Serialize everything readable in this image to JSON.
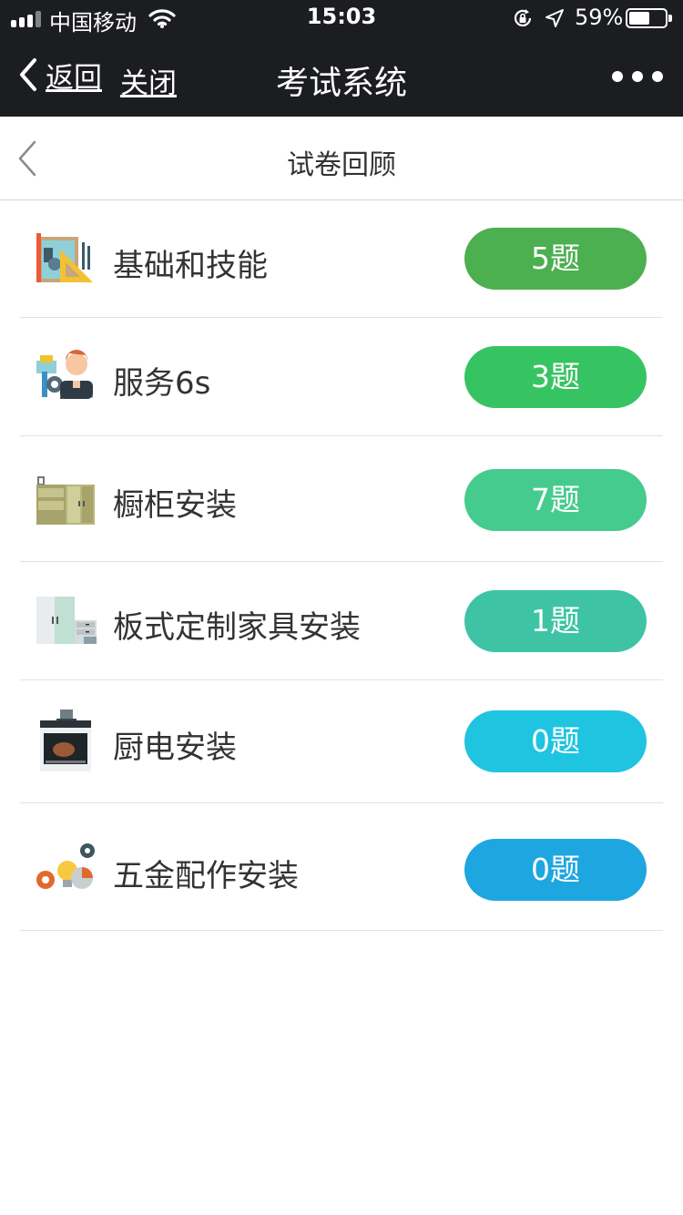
{
  "status_bar": {
    "carrier": "中国移动",
    "time": "15:03",
    "battery_percent": "59%",
    "battery_level": 0.59,
    "icons": [
      "signal-icon",
      "wifi-icon",
      "rotation-lock-icon",
      "location-arrow-icon",
      "battery-icon"
    ]
  },
  "nav": {
    "back_label": "返回",
    "close_label": "关闭",
    "title": "考试系统",
    "more_icon": "more-dots-icon"
  },
  "header": {
    "title": "试卷回顾",
    "back_icon": "chevron-left-icon"
  },
  "categories": [
    {
      "name": "基础和技能",
      "count_label": "5题",
      "color": "#4caf50",
      "icon": "tools-ruler-icon"
    },
    {
      "name": "服务6s",
      "count_label": "3题",
      "color": "#36c462",
      "icon": "service-worker-icon"
    },
    {
      "name": "橱柜安装",
      "count_label": "7题",
      "color": "#46cb8e",
      "icon": "kitchen-cabinet-icon"
    },
    {
      "name": "板式定制家具安装",
      "count_label": "1题",
      "color": "#3ec4a5",
      "icon": "wardrobe-furniture-icon"
    },
    {
      "name": "厨电安装",
      "count_label": "0题",
      "color": "#1ec4e0",
      "icon": "oven-appliance-icon"
    },
    {
      "name": "五金配作安装",
      "count_label": "0题",
      "color": "#1ea6e0",
      "icon": "hardware-gears-icon"
    }
  ]
}
